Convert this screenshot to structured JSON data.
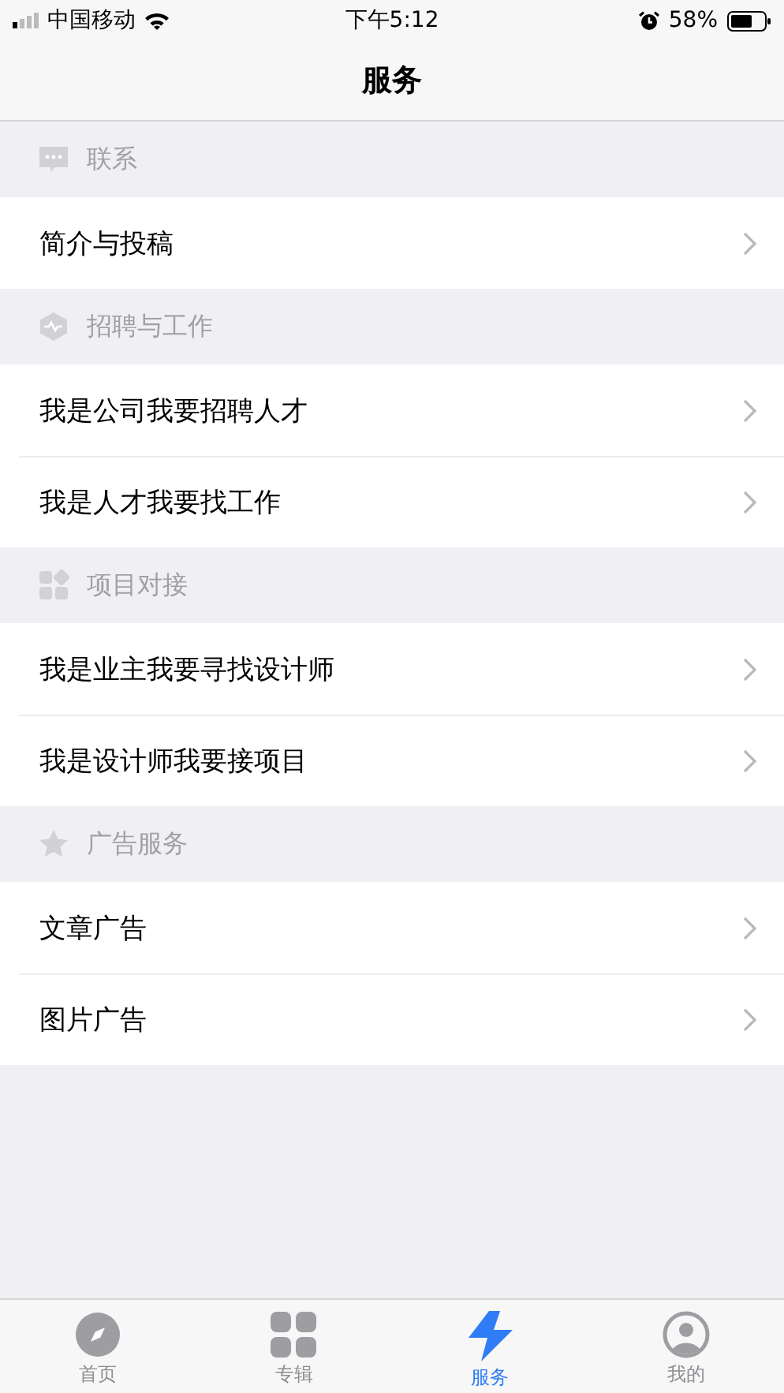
{
  "status_bar": {
    "carrier": "中国移动",
    "time": "下午5:12",
    "battery": "58%"
  },
  "nav": {
    "title": "服务"
  },
  "sections": [
    {
      "title": "联系",
      "items": [
        "简介与投稿"
      ]
    },
    {
      "title": "招聘与工作",
      "items": [
        "我是公司我要招聘人才",
        "我是人才我要找工作"
      ]
    },
    {
      "title": "项目对接",
      "items": [
        "我是业主我要寻找设计师",
        "我是设计师我要接项目"
      ]
    },
    {
      "title": "广告服务",
      "items": [
        "文章广告",
        "图片广告"
      ]
    }
  ],
  "tabs": [
    {
      "label": "首页",
      "selected": false
    },
    {
      "label": "专辑",
      "selected": false
    },
    {
      "label": "服务",
      "selected": true
    },
    {
      "label": "我的",
      "selected": false
    }
  ]
}
